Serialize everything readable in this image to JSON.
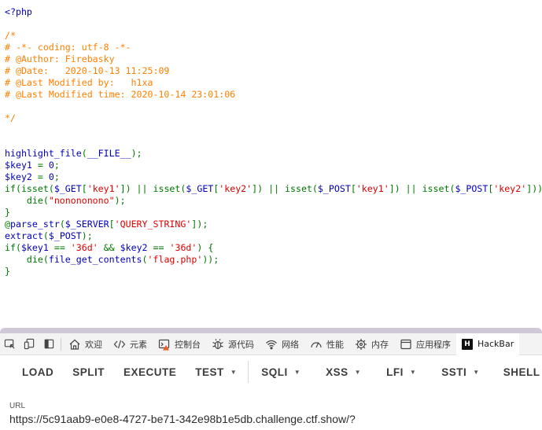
{
  "code": {
    "lines": [
      [
        [
          "default",
          "<?php"
        ]
      ],
      [
        [
          "default",
          ""
        ]
      ],
      [
        [
          "comment",
          "/*"
        ]
      ],
      [
        [
          "comment",
          "# -*- coding: utf-8 -*-"
        ]
      ],
      [
        [
          "comment",
          "# @Author: Firebasky"
        ]
      ],
      [
        [
          "comment",
          "# @Date:   2020-10-13 11:25:09"
        ]
      ],
      [
        [
          "comment",
          "# @Last Modified by:   h1xa"
        ]
      ],
      [
        [
          "comment",
          "# @Last Modified time: 2020-10-14 23:01:06"
        ]
      ],
      [
        [
          "comment",
          ""
        ]
      ],
      [
        [
          "comment",
          "*/"
        ]
      ],
      [
        [
          "default",
          ""
        ]
      ],
      [
        [
          "default",
          ""
        ]
      ],
      [
        [
          "default",
          "highlight_file"
        ],
        [
          "keyword",
          "("
        ],
        [
          "default",
          "__FILE__"
        ],
        [
          "keyword",
          ");"
        ]
      ],
      [
        [
          "default",
          "$key1 "
        ],
        [
          "keyword",
          "= "
        ],
        [
          "default",
          "0"
        ],
        [
          "keyword",
          ";"
        ]
      ],
      [
        [
          "default",
          "$key2 "
        ],
        [
          "keyword",
          "= "
        ],
        [
          "default",
          "0"
        ],
        [
          "keyword",
          ";"
        ]
      ],
      [
        [
          "keyword",
          "if(isset("
        ],
        [
          "default",
          "$_GET"
        ],
        [
          "keyword",
          "["
        ],
        [
          "string",
          "'key1'"
        ],
        [
          "keyword",
          "]) || isset("
        ],
        [
          "default",
          "$_GET"
        ],
        [
          "keyword",
          "["
        ],
        [
          "string",
          "'key2'"
        ],
        [
          "keyword",
          "]) || isset("
        ],
        [
          "default",
          "$_POST"
        ],
        [
          "keyword",
          "["
        ],
        [
          "string",
          "'key1'"
        ],
        [
          "keyword",
          "]) || isset("
        ],
        [
          "default",
          "$_POST"
        ],
        [
          "keyword",
          "["
        ],
        [
          "string",
          "'key2'"
        ],
        [
          "keyword",
          "])) {"
        ]
      ],
      [
        [
          "keyword",
          "    die("
        ],
        [
          "string",
          "\"nonononono\""
        ],
        [
          "keyword",
          ");"
        ]
      ],
      [
        [
          "keyword",
          "}"
        ]
      ],
      [
        [
          "keyword",
          "@"
        ],
        [
          "default",
          "parse_str"
        ],
        [
          "keyword",
          "("
        ],
        [
          "default",
          "$_SERVER"
        ],
        [
          "keyword",
          "["
        ],
        [
          "string",
          "'QUERY_STRING'"
        ],
        [
          "keyword",
          "]);"
        ]
      ],
      [
        [
          "default",
          "extract"
        ],
        [
          "keyword",
          "("
        ],
        [
          "default",
          "$_POST"
        ],
        [
          "keyword",
          ");"
        ]
      ],
      [
        [
          "keyword",
          "if("
        ],
        [
          "default",
          "$key1 "
        ],
        [
          "keyword",
          "== "
        ],
        [
          "string",
          "'36d' "
        ],
        [
          "keyword",
          "&& "
        ],
        [
          "default",
          "$key2 "
        ],
        [
          "keyword",
          "== "
        ],
        [
          "string",
          "'36d'"
        ],
        [
          "keyword",
          ") {"
        ]
      ],
      [
        [
          "keyword",
          "    die("
        ],
        [
          "default",
          "file_get_contents"
        ],
        [
          "keyword",
          "("
        ],
        [
          "string",
          "'flag.php'"
        ],
        [
          "keyword",
          "));"
        ]
      ],
      [
        [
          "keyword",
          "}"
        ]
      ]
    ],
    "colors": {
      "default": "#0000BB",
      "comment": "#FF8000",
      "keyword": "#007700",
      "string": "#DD0000"
    }
  },
  "devtools": {
    "tools": [
      {
        "name": "inspect-icon"
      },
      {
        "name": "device-emulation-icon"
      },
      {
        "name": "dock-panel-icon"
      }
    ],
    "tabs": [
      {
        "label": "欢迎",
        "icon": "home-icon"
      },
      {
        "label": "元素",
        "icon": "code-brackets-icon"
      },
      {
        "label": "控制台",
        "icon": "console-icon"
      },
      {
        "label": "源代码",
        "icon": "bug-icon"
      },
      {
        "label": "网络",
        "icon": "wifi-icon"
      },
      {
        "label": "性能",
        "icon": "gauge-icon"
      },
      {
        "label": "内存",
        "icon": "memory-chip-icon"
      },
      {
        "label": "应用程序",
        "icon": "application-window-icon"
      }
    ],
    "active_tab": {
      "label": "HackBar",
      "badge": "H"
    }
  },
  "hackbar": {
    "buttons": [
      {
        "label": "LOAD",
        "dropdown": false
      },
      {
        "label": "SPLIT",
        "dropdown": false
      },
      {
        "label": "EXECUTE",
        "dropdown": false
      },
      {
        "label": "TEST",
        "dropdown": true
      },
      {
        "label": "SQLI",
        "dropdown": true
      },
      {
        "label": "XSS",
        "dropdown": true
      },
      {
        "label": "LFI",
        "dropdown": true
      },
      {
        "label": "SSTI",
        "dropdown": true
      },
      {
        "label": "SHELL",
        "dropdown": false
      }
    ],
    "caret_glyph": "▼"
  },
  "url": {
    "label": "URL",
    "value": "https://5c91aab9-e0e8-4727-be71-342e98b1e5db.challenge.ctf.show/?"
  }
}
